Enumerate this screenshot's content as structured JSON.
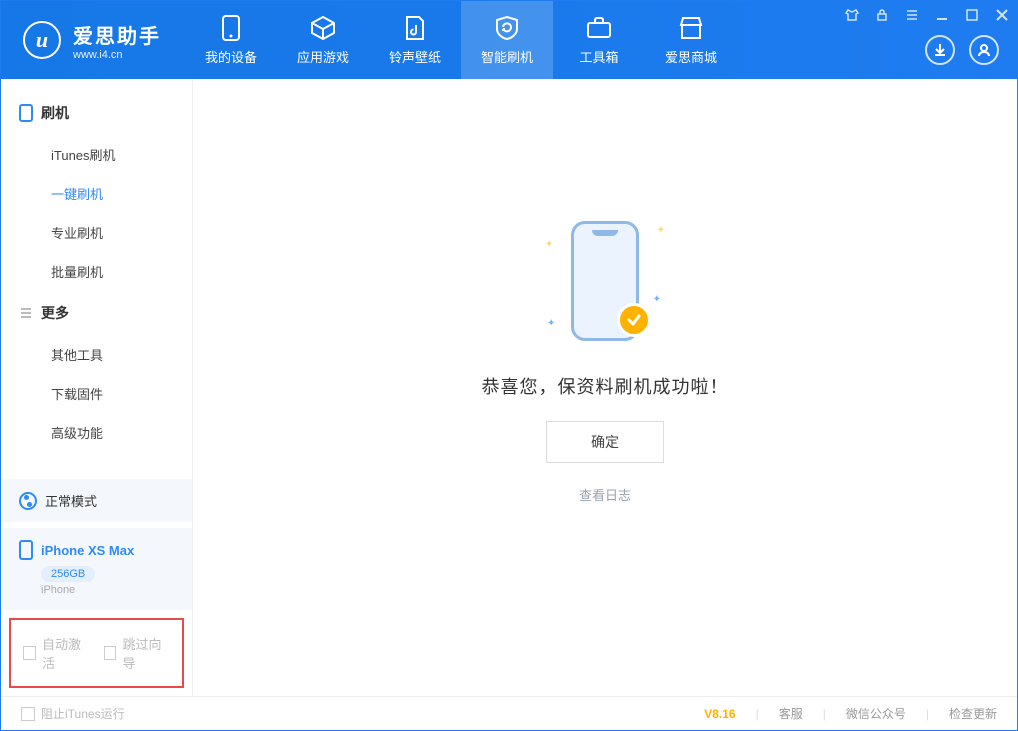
{
  "brand": {
    "name": "爱思助手",
    "url": "www.i4.cn",
    "logo_letter": "u"
  },
  "tabs": [
    {
      "id": "device",
      "label": "我的设备"
    },
    {
      "id": "apps",
      "label": "应用游戏"
    },
    {
      "id": "media",
      "label": "铃声壁纸"
    },
    {
      "id": "flash",
      "label": "智能刷机",
      "active": true
    },
    {
      "id": "tools",
      "label": "工具箱"
    },
    {
      "id": "store",
      "label": "爱思商城"
    }
  ],
  "sidebar": {
    "sections": [
      {
        "title": "刷机",
        "items": [
          "iTunes刷机",
          "一键刷机",
          "专业刷机",
          "批量刷机"
        ],
        "active_index": 1
      },
      {
        "title": "更多",
        "items": [
          "其他工具",
          "下载固件",
          "高级功能"
        ]
      }
    ],
    "mode_label": "正常模式",
    "device": {
      "name": "iPhone XS Max",
      "capacity": "256GB",
      "type": "iPhone"
    },
    "options": {
      "auto_activate": "自动激活",
      "skip_guide": "跳过向导"
    }
  },
  "main": {
    "success_message": "恭喜您，保资料刷机成功啦！",
    "confirm_label": "确定",
    "view_log_label": "查看日志"
  },
  "footer": {
    "block_itunes": "阻止iTunes运行",
    "version": "V8.16",
    "links": [
      "客服",
      "微信公众号",
      "检查更新"
    ]
  }
}
